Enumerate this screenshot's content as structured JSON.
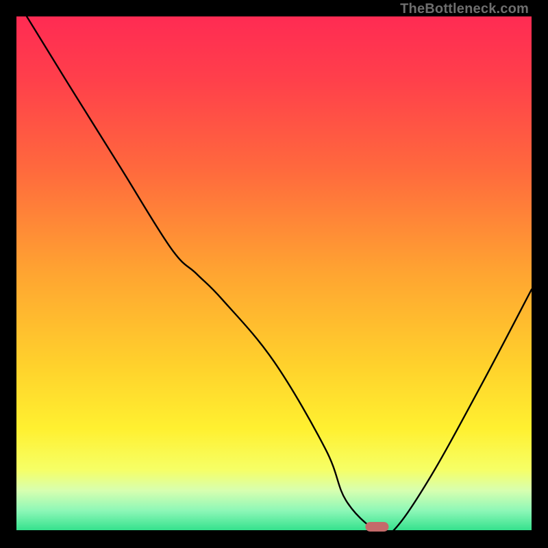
{
  "watermark": "TheBottleneck.com",
  "chart_data": {
    "type": "line",
    "title": "",
    "xlabel": "",
    "ylabel": "",
    "xlim": [
      0,
      100
    ],
    "ylim": [
      0,
      100
    ],
    "grid": false,
    "legend": false,
    "series": [
      {
        "name": "bottleneck-curve",
        "x": [
          2,
          10,
          20,
          30,
          35,
          40,
          50,
          60,
          64,
          70,
          73,
          80,
          90,
          100
        ],
        "y": [
          100,
          87,
          71,
          55,
          50,
          45,
          33,
          16,
          6,
          0,
          0,
          10,
          28,
          47
        ]
      }
    ],
    "marker": {
      "x": 70,
      "y": 0.5,
      "color": "#c46a6a"
    },
    "gradient_stops": [
      {
        "offset": 0.0,
        "color": "#ff2b53"
      },
      {
        "offset": 0.12,
        "color": "#ff3f4b"
      },
      {
        "offset": 0.3,
        "color": "#ff6a3d"
      },
      {
        "offset": 0.5,
        "color": "#ffa531"
      },
      {
        "offset": 0.68,
        "color": "#ffd22c"
      },
      {
        "offset": 0.8,
        "color": "#fff030"
      },
      {
        "offset": 0.88,
        "color": "#f6ff66"
      },
      {
        "offset": 0.92,
        "color": "#d8ffb0"
      },
      {
        "offset": 0.96,
        "color": "#8cf7b7"
      },
      {
        "offset": 1.0,
        "color": "#2fe08a"
      }
    ]
  }
}
